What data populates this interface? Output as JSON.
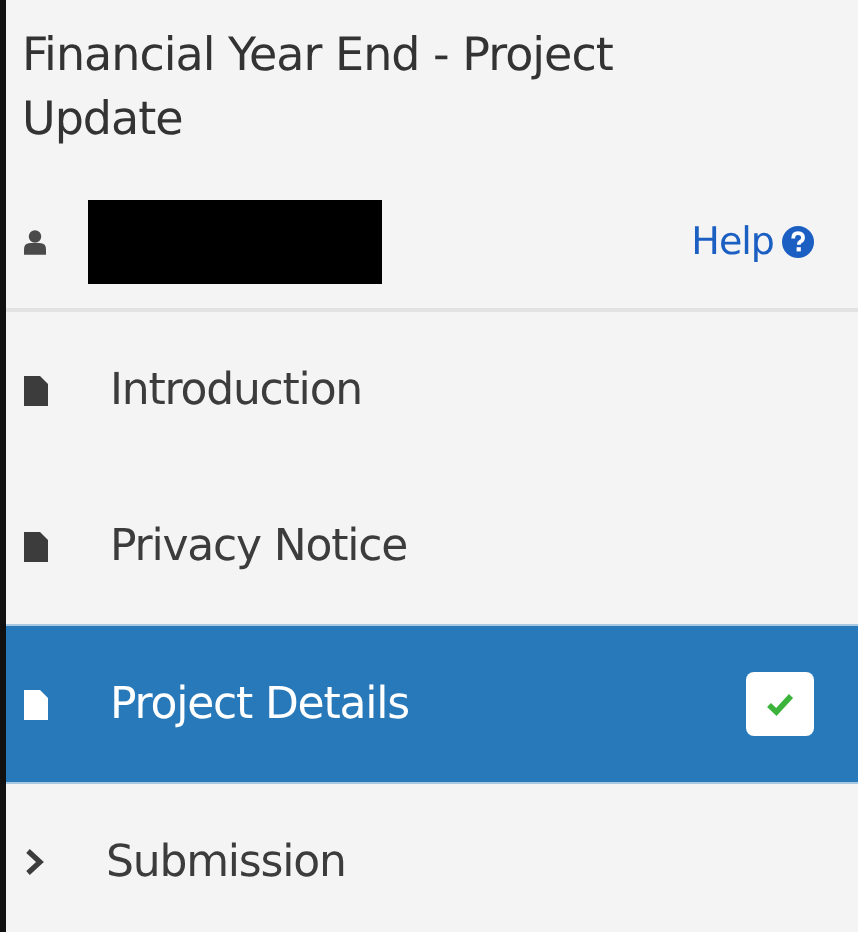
{
  "title": "Financial Year End - Project Update",
  "user_bar": {
    "help_link": "Help"
  },
  "nav_items": [
    {
      "label": "Introduction",
      "kind": "page",
      "selected": false,
      "completed": false
    },
    {
      "label": "Privacy Notice",
      "kind": "page",
      "selected": false,
      "completed": false
    },
    {
      "label": "Project Details",
      "kind": "page",
      "selected": true,
      "completed": true
    },
    {
      "label": "Submission",
      "kind": "section",
      "selected": false,
      "completed": false
    }
  ]
}
